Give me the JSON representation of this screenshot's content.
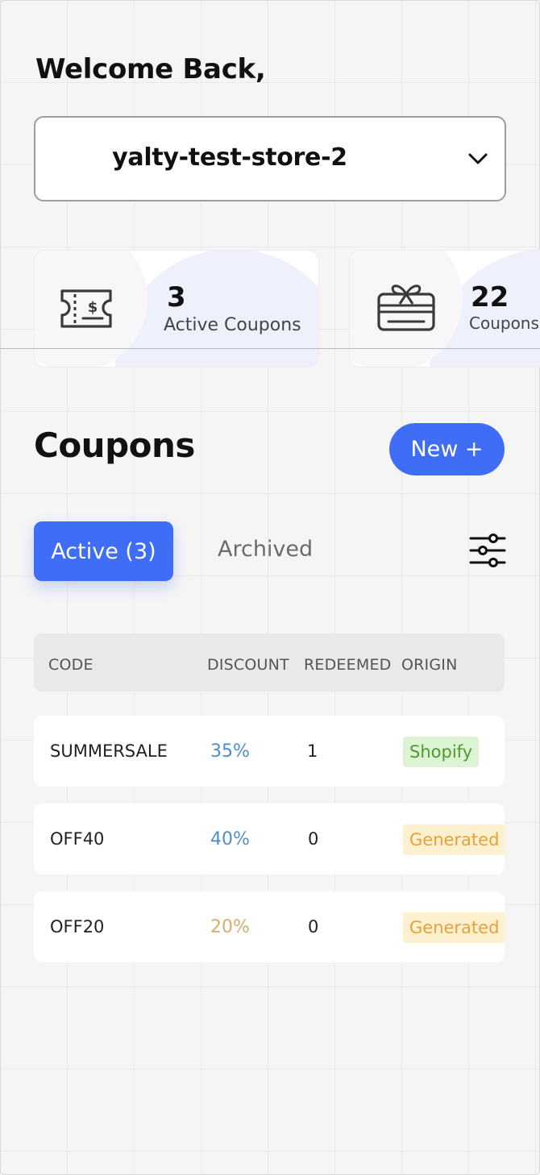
{
  "header": {
    "welcome": "Welcome Back,"
  },
  "store_selector": {
    "value": "yalty-test-store-2",
    "icon": "chevron-down-icon"
  },
  "stats": [
    {
      "value": "3",
      "label": "Active Coupons",
      "icon": "coupon-ticket-icon"
    },
    {
      "value": "22",
      "label": "Coupons R",
      "icon": "gift-card-icon"
    }
  ],
  "coupons": {
    "title": "Coupons",
    "new_button": "New +",
    "tabs": {
      "active": "Active (3)",
      "archived": "Archived"
    },
    "filter_icon": "sliders-icon",
    "columns": [
      "CODE",
      "DISCOUNT",
      "REDEEMED",
      "ORIGIN"
    ],
    "rows": [
      {
        "code": "SUMMERSALE",
        "discount": "35%",
        "redeemed": "1",
        "origin": "Shopify",
        "discount_color": "#4e8fc9",
        "origin_bg": "#dcf3d4",
        "origin_fg": "#4f9a2f"
      },
      {
        "code": "OFF40",
        "discount": "40%",
        "redeemed": "0",
        "origin": "Generated",
        "discount_color": "#4e8fc9",
        "origin_bg": "#fdf0cf",
        "origin_fg": "#e6a13a"
      },
      {
        "code": "OFF20",
        "discount": "20%",
        "redeemed": "0",
        "origin": "Generated",
        "discount_color": "#d9ad6b",
        "origin_bg": "#fdf0cf",
        "origin_fg": "#e6a13a"
      }
    ]
  }
}
